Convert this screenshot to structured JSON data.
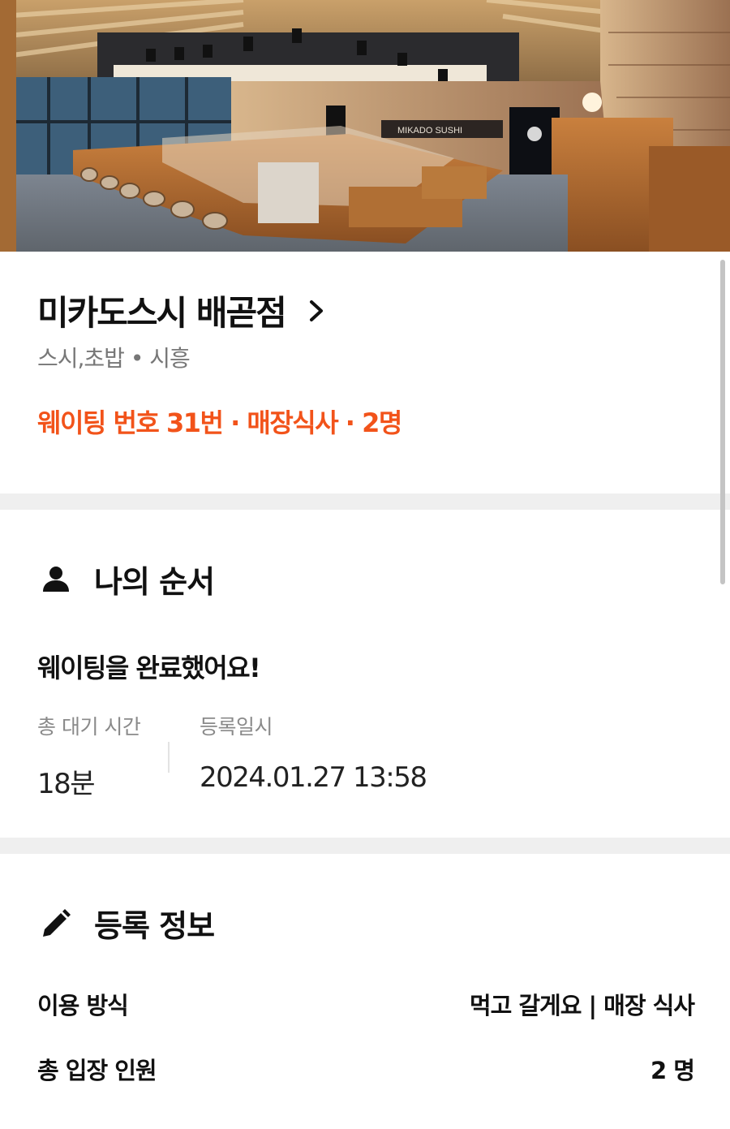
{
  "store": {
    "name": "미카도스시 배곧점",
    "category": "스시,초밥 • 시흥",
    "status": "웨이팅 번호 31번 · 매장식사 · 2명"
  },
  "hero": {
    "photo_alt": "store-interior-photo",
    "sign_text": "MIKADO SUSHI"
  },
  "my_turn": {
    "title": "나의 순서",
    "message": "웨이팅을 완료했어요!",
    "wait_label": "총 대기 시간",
    "wait_value": "18분",
    "registered_label": "등록일시",
    "registered_value": "2024.01.27 13:58"
  },
  "registration": {
    "title": "등록 정보",
    "rows": [
      {
        "label": "이용 방식",
        "value": "먹고 갈게요 | 매장 식사"
      },
      {
        "label": "총 입장 인원",
        "value": "2 명"
      }
    ]
  },
  "colors": {
    "accent": "#f2531a",
    "divider": "#efefef",
    "muted": "#8a8a8a"
  },
  "icons": {
    "chevron": "chevron-right-icon",
    "person": "person-icon",
    "pencil": "pencil-icon"
  }
}
